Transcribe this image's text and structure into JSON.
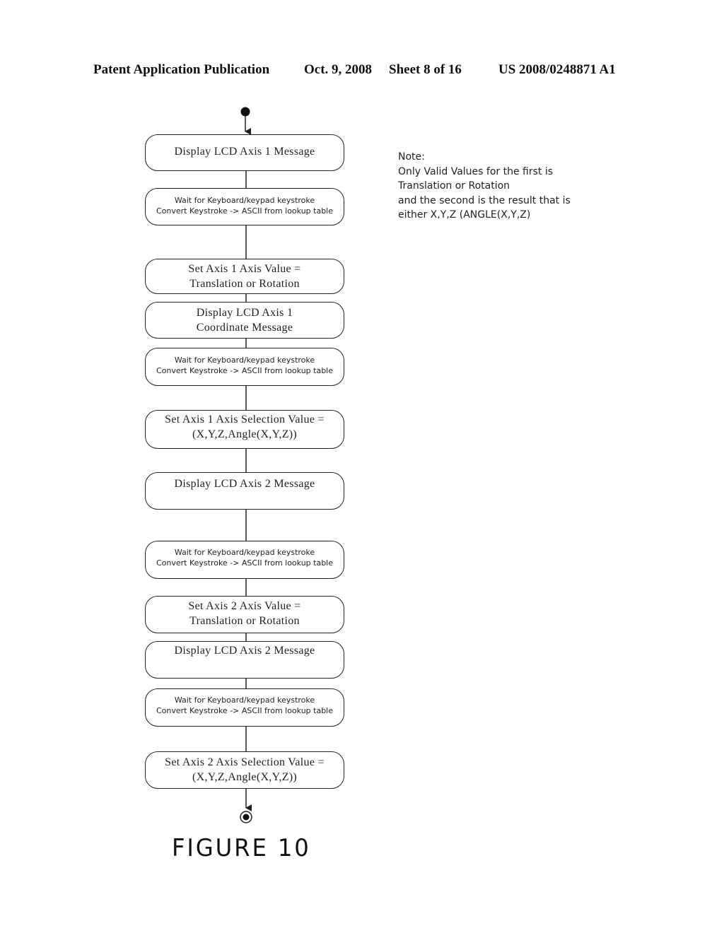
{
  "header": {
    "publication": "Patent Application Publication",
    "date": "Oct. 9, 2008",
    "sheet": "Sheet 8 of 16",
    "patent_number": "US 2008/0248871 A1"
  },
  "flowchart": {
    "start_node": "initial-state",
    "end_node": "final-state",
    "steps": [
      {
        "lines": [
          "Display LCD Axis 1 Message"
        ]
      },
      {
        "lines": [
          "Wait for Keyboard/keypad keystroke",
          "Convert Keystroke -> ASCII from lookup table"
        ]
      },
      {
        "lines": [
          "Set Axis 1 Axis Value =",
          "Translation or Rotation"
        ]
      },
      {
        "lines": [
          "Display LCD Axis 1",
          "Coordinate Message"
        ]
      },
      {
        "lines": [
          "Wait for Keyboard/keypad keystroke",
          "Convert Keystroke -> ASCII from lookup table"
        ]
      },
      {
        "lines": [
          "Set Axis 1 Axis Selection Value =",
          "(X,Y,Z,Angle(X,Y,Z))"
        ]
      },
      {
        "lines": [
          "Display LCD Axis 2 Message"
        ]
      },
      {
        "lines": [
          "Wait for Keyboard/keypad keystroke",
          "Convert Keystroke -> ASCII from lookup table"
        ]
      },
      {
        "lines": [
          "Set Axis 2 Axis Value =",
          "Translation or Rotation"
        ]
      },
      {
        "lines": [
          "Display LCD Axis 2 Message"
        ]
      },
      {
        "lines": [
          "Wait for Keyboard/keypad keystroke",
          "Convert Keystroke -> ASCII from lookup table"
        ]
      },
      {
        "lines": [
          "Set Axis 2 Axis Selection Value =",
          "(X,Y,Z,Angle(X,Y,Z))"
        ]
      }
    ]
  },
  "note": {
    "lines": [
      "Note:",
      "Only Valid Values for the first is",
      "Translation or Rotation",
      "and the second is the result that is",
      "either X,Y,Z (ANGLE(X,Y,Z)"
    ]
  },
  "figure_label": "FIGURE 10"
}
